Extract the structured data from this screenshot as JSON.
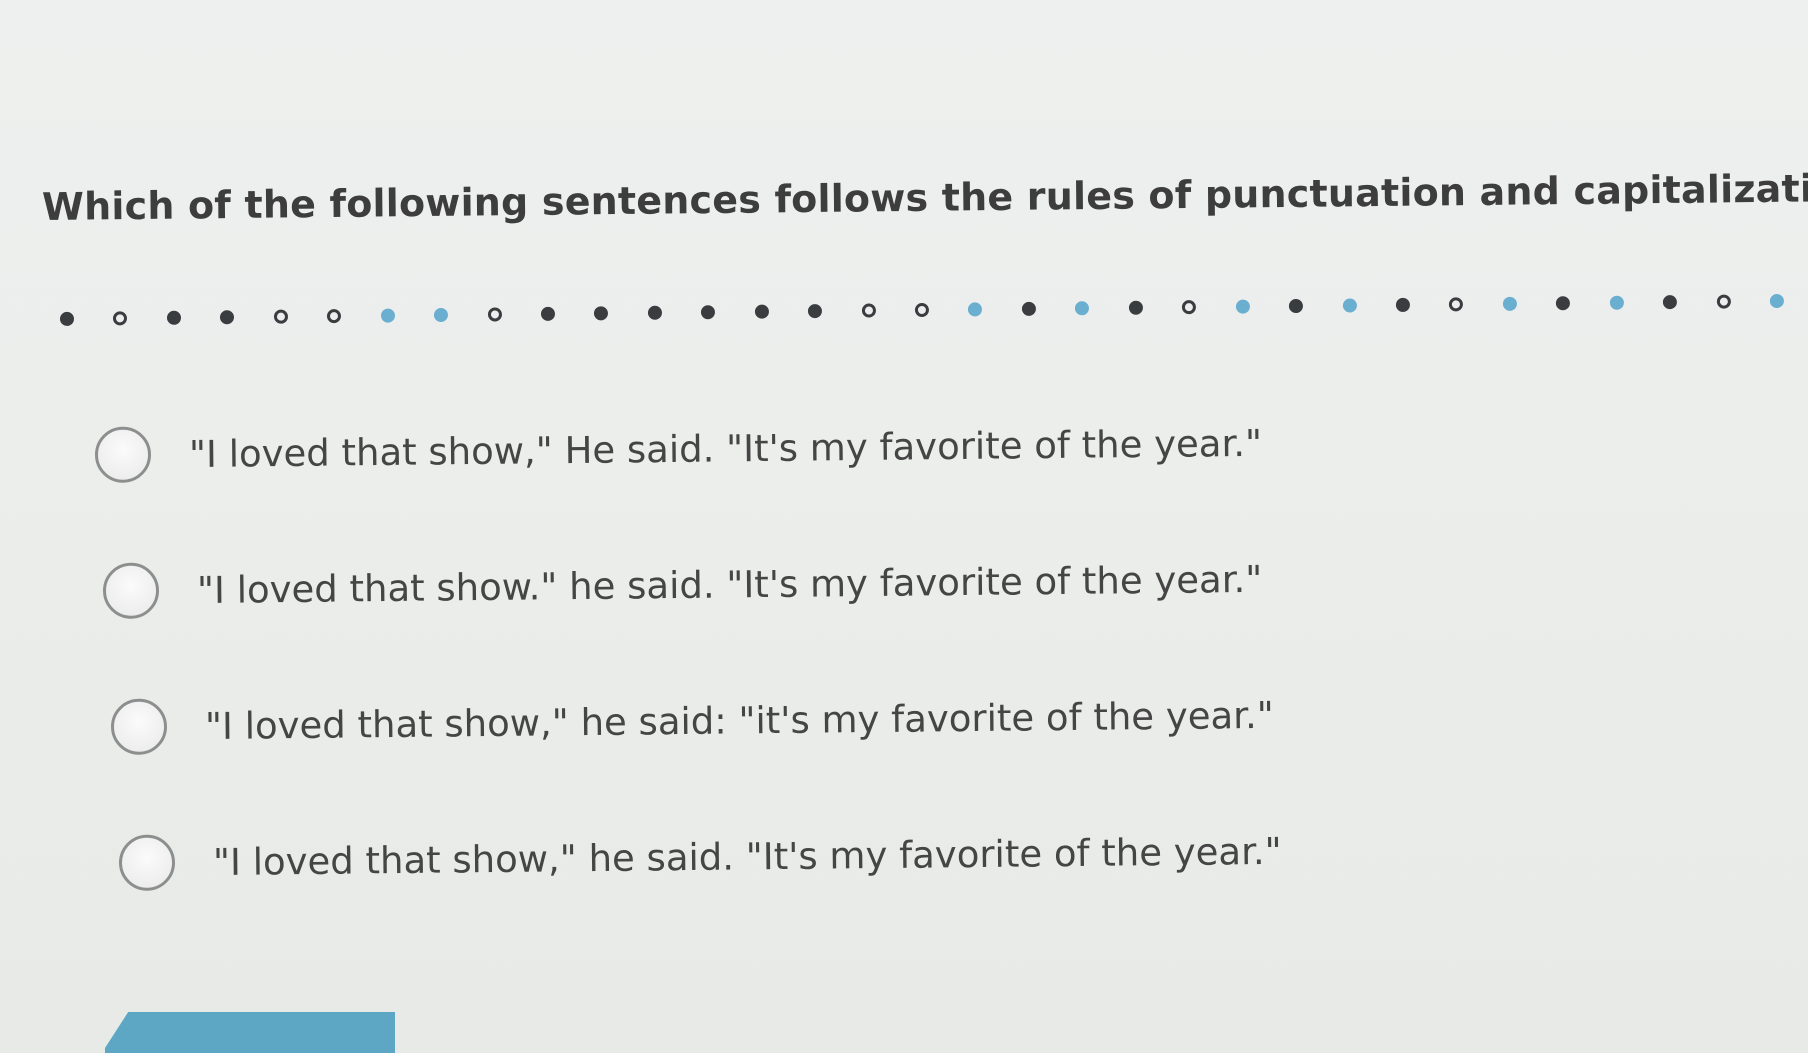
{
  "question": {
    "text": "Which of the following sentences follows the rules of punctuation and capitalization?"
  },
  "progress": {
    "states": [
      "filled",
      "open",
      "filled",
      "filled",
      "open",
      "open",
      "current",
      "current",
      "open",
      "filled",
      "filled",
      "filled",
      "filled",
      "filled",
      "filled",
      "open",
      "open",
      "current",
      "filled",
      "current",
      "filled",
      "open",
      "current",
      "filled",
      "current",
      "filled",
      "open",
      "current",
      "filled",
      "current",
      "filled",
      "open",
      "current"
    ]
  },
  "options": [
    {
      "label": "\"I loved that show,\" He said. \"It's my favorite of the year.\""
    },
    {
      "label": "\"I loved that show.\" he said. \"It's my favorite of the year.\""
    },
    {
      "label": "\"I loved that show,\" he said: \"it's my favorite of the year.\""
    },
    {
      "label": "\"I loved that show,\" he said. \"It's my favorite of the year.\""
    }
  ],
  "colors": {
    "accent": "#5ea7c4",
    "current_dot": "#6aaed0",
    "dot": "#3a3d40",
    "text": "#3d3d3d"
  }
}
